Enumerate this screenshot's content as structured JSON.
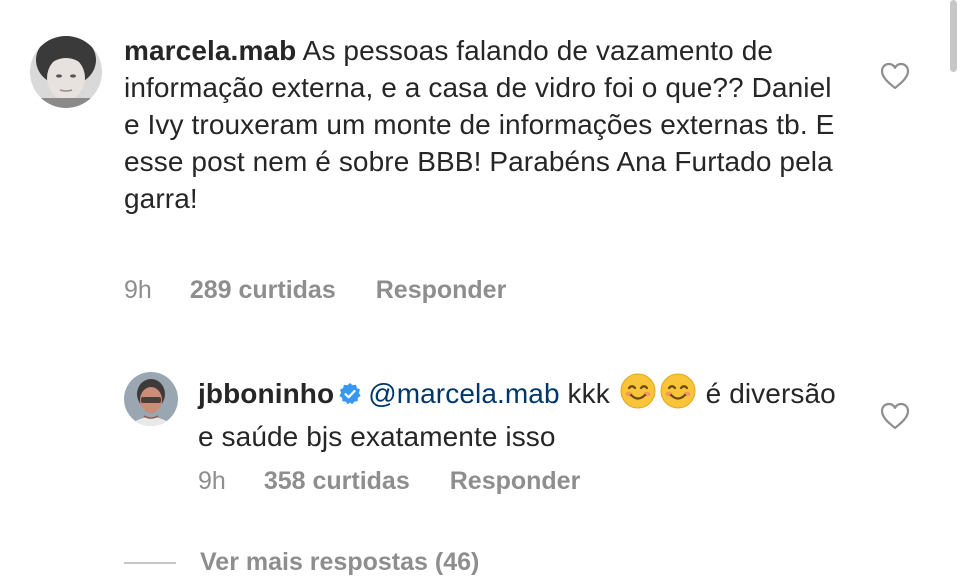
{
  "comments": [
    {
      "username": "marcela.mab",
      "text": "As pessoas falando de vazamento de informação externa, e a casa de vidro foi o que?? Daniel e Ivy trouxeram um monte de informações externas tb. E esse post nem é sobre BBB! Parabéns Ana Furtado pela garra!",
      "time": "9h",
      "likes": "289 curtidas",
      "reply_label": "Responder",
      "like_icon": "heart-outline-icon"
    }
  ],
  "reply": {
    "username": "jbboninho",
    "verified_icon": "verified-badge-icon",
    "mention": "@marcela.mab",
    "text_before_emoji": "kkk",
    "emojis": [
      "smiling-face-icon",
      "smiling-face-icon"
    ],
    "text_after_emoji": "é diversão e saúde bjs exatamente isso",
    "time": "9h",
    "likes": "358 curtidas",
    "reply_label": "Responder",
    "like_icon": "heart-outline-icon"
  },
  "view_more": {
    "label": "Ver mais respostas (46)"
  },
  "colors": {
    "text": "#262626",
    "secondary": "#8e8e8e",
    "mention": "#00376b",
    "verified": "#3897f0"
  }
}
